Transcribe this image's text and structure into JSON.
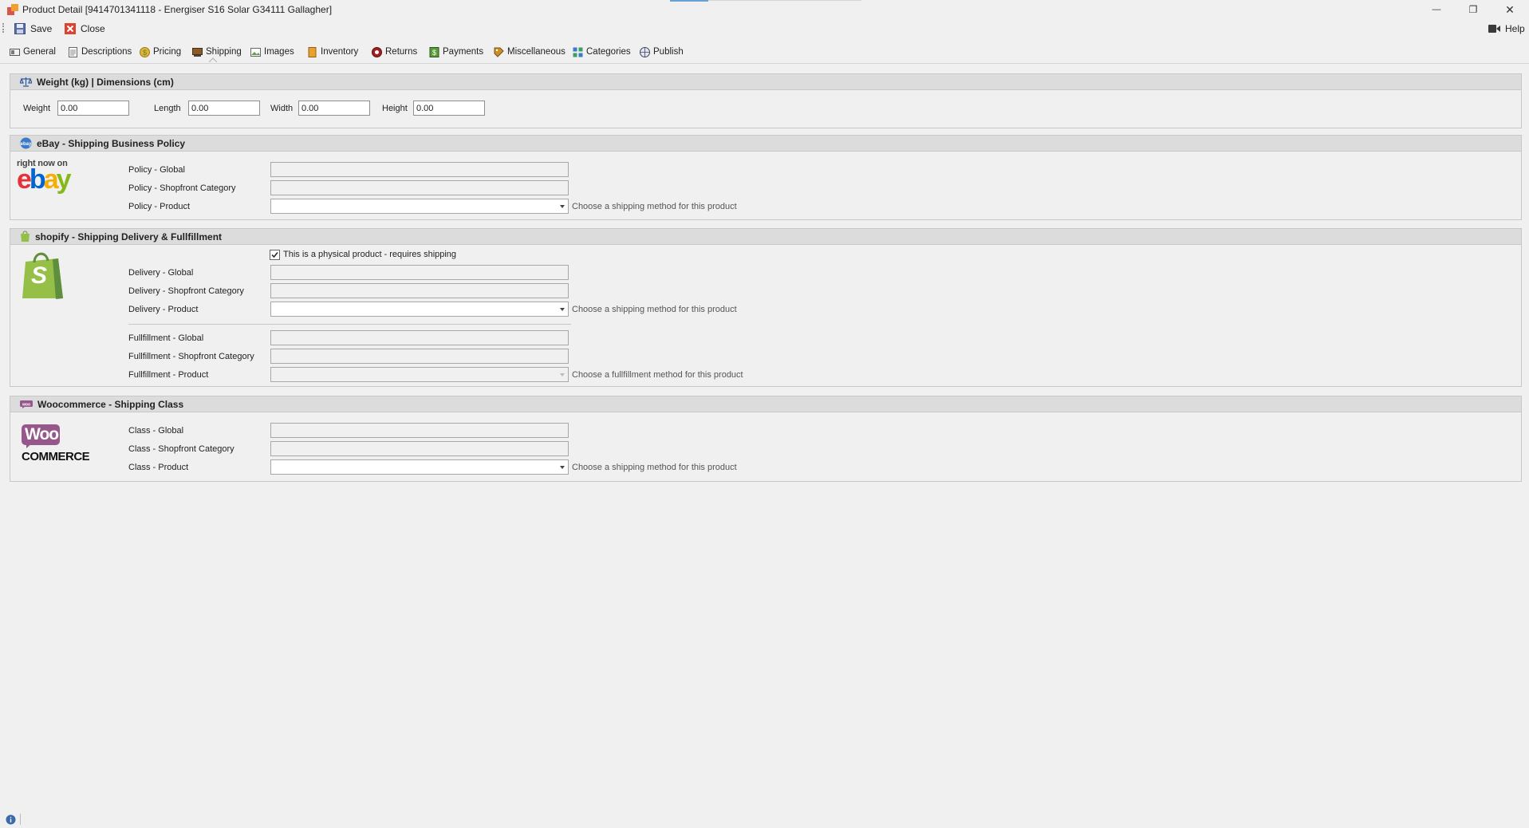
{
  "window": {
    "title": "Product Detail [9414701341118 - Energiser S16 Solar G34111 Gallagher]",
    "minimize_glyph": "—",
    "restore_glyph": "❐",
    "close_glyph": "✕"
  },
  "toolbar": {
    "save_label": "Save",
    "close_label": "Close",
    "help_label": "Help"
  },
  "tabs": [
    {
      "label": "General",
      "icon": "general-icon"
    },
    {
      "label": "Descriptions",
      "icon": "descriptions-icon"
    },
    {
      "label": "Pricing",
      "icon": "pricing-icon"
    },
    {
      "label": "Shipping",
      "icon": "shipping-icon",
      "active": true
    },
    {
      "label": "Images",
      "icon": "images-icon"
    },
    {
      "label": "Inventory",
      "icon": "inventory-icon"
    },
    {
      "label": "Returns",
      "icon": "returns-icon"
    },
    {
      "label": "Payments",
      "icon": "payments-icon"
    },
    {
      "label": "Miscellaneous",
      "icon": "miscellaneous-icon"
    },
    {
      "label": "Categories",
      "icon": "categories-icon"
    },
    {
      "label": "Publish",
      "icon": "publish-icon"
    }
  ],
  "weight_section": {
    "title": "Weight (kg) | Dimensions (cm)",
    "weight_label": "Weight",
    "weight_value": "0.00",
    "length_label": "Length",
    "length_value": "0.00",
    "width_label": "Width",
    "width_value": "0.00",
    "height_label": "Height",
    "height_value": "0.00"
  },
  "ebay_section": {
    "title": "eBay - Shipping Business Policy",
    "logo_top": "right now on",
    "logo_letters": [
      "e",
      "b",
      "a",
      "y"
    ],
    "logo_colors": [
      "#e53238",
      "#0064d2",
      "#f5af02",
      "#86b817"
    ],
    "global_label": "Policy - Global",
    "global_value": "",
    "category_label": "Policy - Shopfront Category",
    "category_value": "",
    "product_label": "Policy - Product",
    "product_value": "",
    "product_hint": "Choose a shipping method for this product"
  },
  "shopify_section": {
    "title": "shopify - Shipping Delivery & Fullfillment",
    "logo_letter": "S",
    "brand_color": "#95bf47",
    "physical_checkbox_label": "This is a physical product - requires shipping",
    "physical_checked": true,
    "delivery_global_label": "Delivery - Global",
    "delivery_global_value": "",
    "delivery_category_label": "Delivery - Shopfront Category",
    "delivery_category_value": "",
    "delivery_product_label": "Delivery - Product",
    "delivery_product_value": "",
    "delivery_product_hint": "Choose a shipping method for this product",
    "fulfillment_global_label": "Fullfillment - Global",
    "fulfillment_global_value": "",
    "fulfillment_category_label": "Fullfillment - Shopfront Category",
    "fulfillment_category_value": "",
    "fulfillment_product_label": "Fullfillment - Product",
    "fulfillment_product_value": "",
    "fulfillment_product_hint": "Choose a fullfillment method for this product"
  },
  "woo_section": {
    "title": "Woocommerce - Shipping Class",
    "logo_top": "Woo",
    "logo_bottom": "COMMERCE",
    "brand_color": "#96588a",
    "global_label": "Class - Global",
    "global_value": "",
    "category_label": "Class - Shopfront Category",
    "category_value": "",
    "product_label": "Class - Product",
    "product_value": "",
    "product_hint": "Choose a shipping method for this product"
  }
}
